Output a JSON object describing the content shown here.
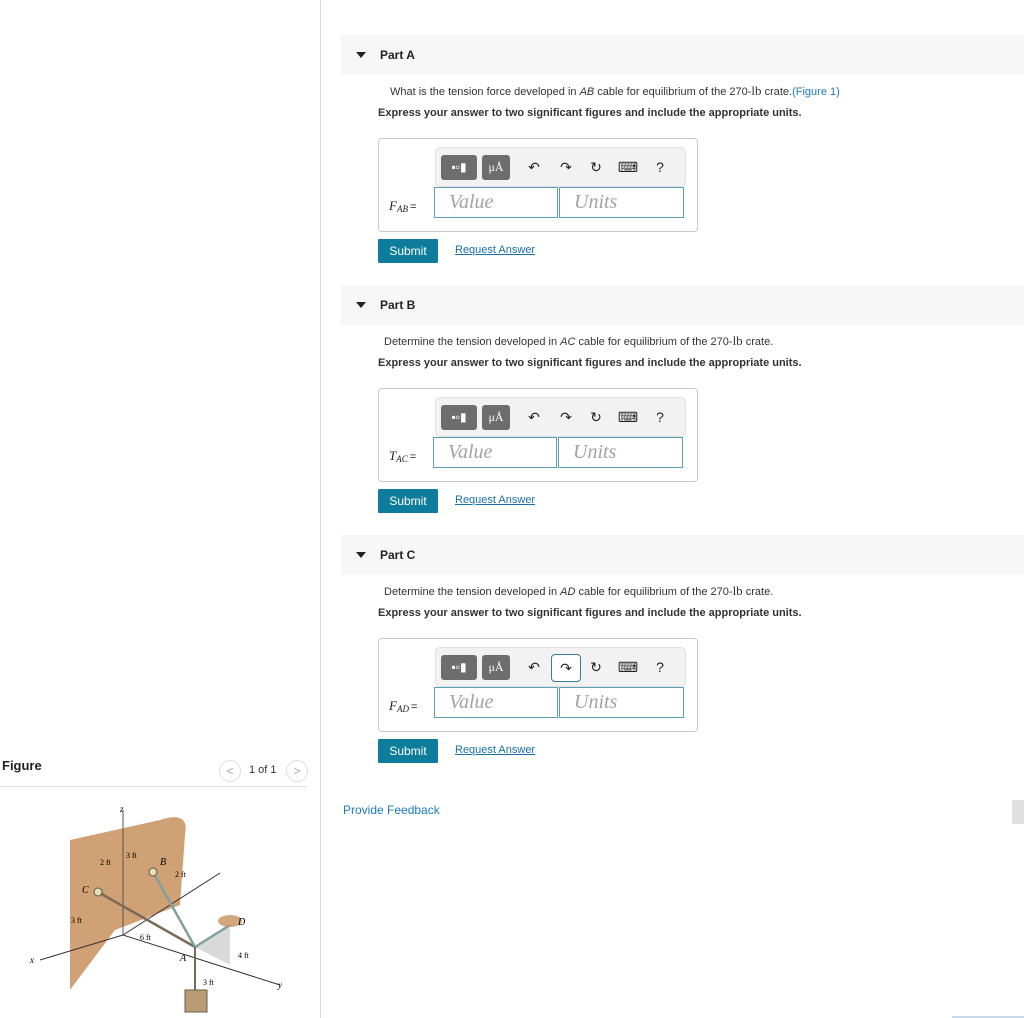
{
  "parts": [
    {
      "title": "Part A",
      "question_prefix": "What is the tension force developed in ",
      "cable": "AB",
      "question_mid": " cable for equilibrium of the 270-",
      "unit": "lb",
      "question_suffix": " crate.",
      "figure_link": "(Figure 1)",
      "instruction": "Express your answer to two significant figures and include the appropriate units.",
      "var_main": "F",
      "var_sub": "AB",
      "value_placeholder": "Value",
      "units_placeholder": "Units",
      "submit_label": "Submit",
      "request_label": "Request Answer"
    },
    {
      "title": "Part B",
      "question_prefix": "Determine the tension developed in ",
      "cable": "AC",
      "question_mid": " cable for equilibrium of the 270-",
      "unit": "lb",
      "question_suffix": " crate.",
      "figure_link": "",
      "instruction": "Express your answer to two significant figures and include the appropriate units.",
      "var_main": "T",
      "var_sub": "AC",
      "value_placeholder": "Value",
      "units_placeholder": "Units",
      "submit_label": "Submit",
      "request_label": "Request Answer"
    },
    {
      "title": "Part C",
      "question_prefix": "Determine the tension developed in ",
      "cable": "AD",
      "question_mid": " cable for equilibrium of the 270-",
      "unit": "lb",
      "question_suffix": " crate.",
      "figure_link": "",
      "instruction": "Express your answer to two significant figures and include the appropriate units.",
      "var_main": "F",
      "var_sub": "AD",
      "value_placeholder": "Value",
      "units_placeholder": "Units",
      "submit_label": "Submit",
      "request_label": "Request Answer"
    }
  ],
  "toolbar": {
    "template_icon": "fraction-template-icon",
    "units_label": "μÅ",
    "undo": "↶",
    "redo": "↷",
    "reset": "↻",
    "keyboard": "⌨",
    "help": "?"
  },
  "feedback_label": "Provide Feedback",
  "figure": {
    "title": "Figure",
    "counter": "1 of 1",
    "prev": "<",
    "next": ">",
    "labels": {
      "z": "z",
      "x": "x",
      "y": "y",
      "A": "A",
      "B": "B",
      "C": "C",
      "D": "D",
      "d_2ft_a": "2 ft",
      "d_3ft_a": "3 ft",
      "d_2ft_b": "2 ft",
      "d_3ft_b": "3 ft",
      "d_6ft": "6 ft",
      "d_4ft": "4 ft",
      "d_3ft_c": "3 ft"
    }
  }
}
